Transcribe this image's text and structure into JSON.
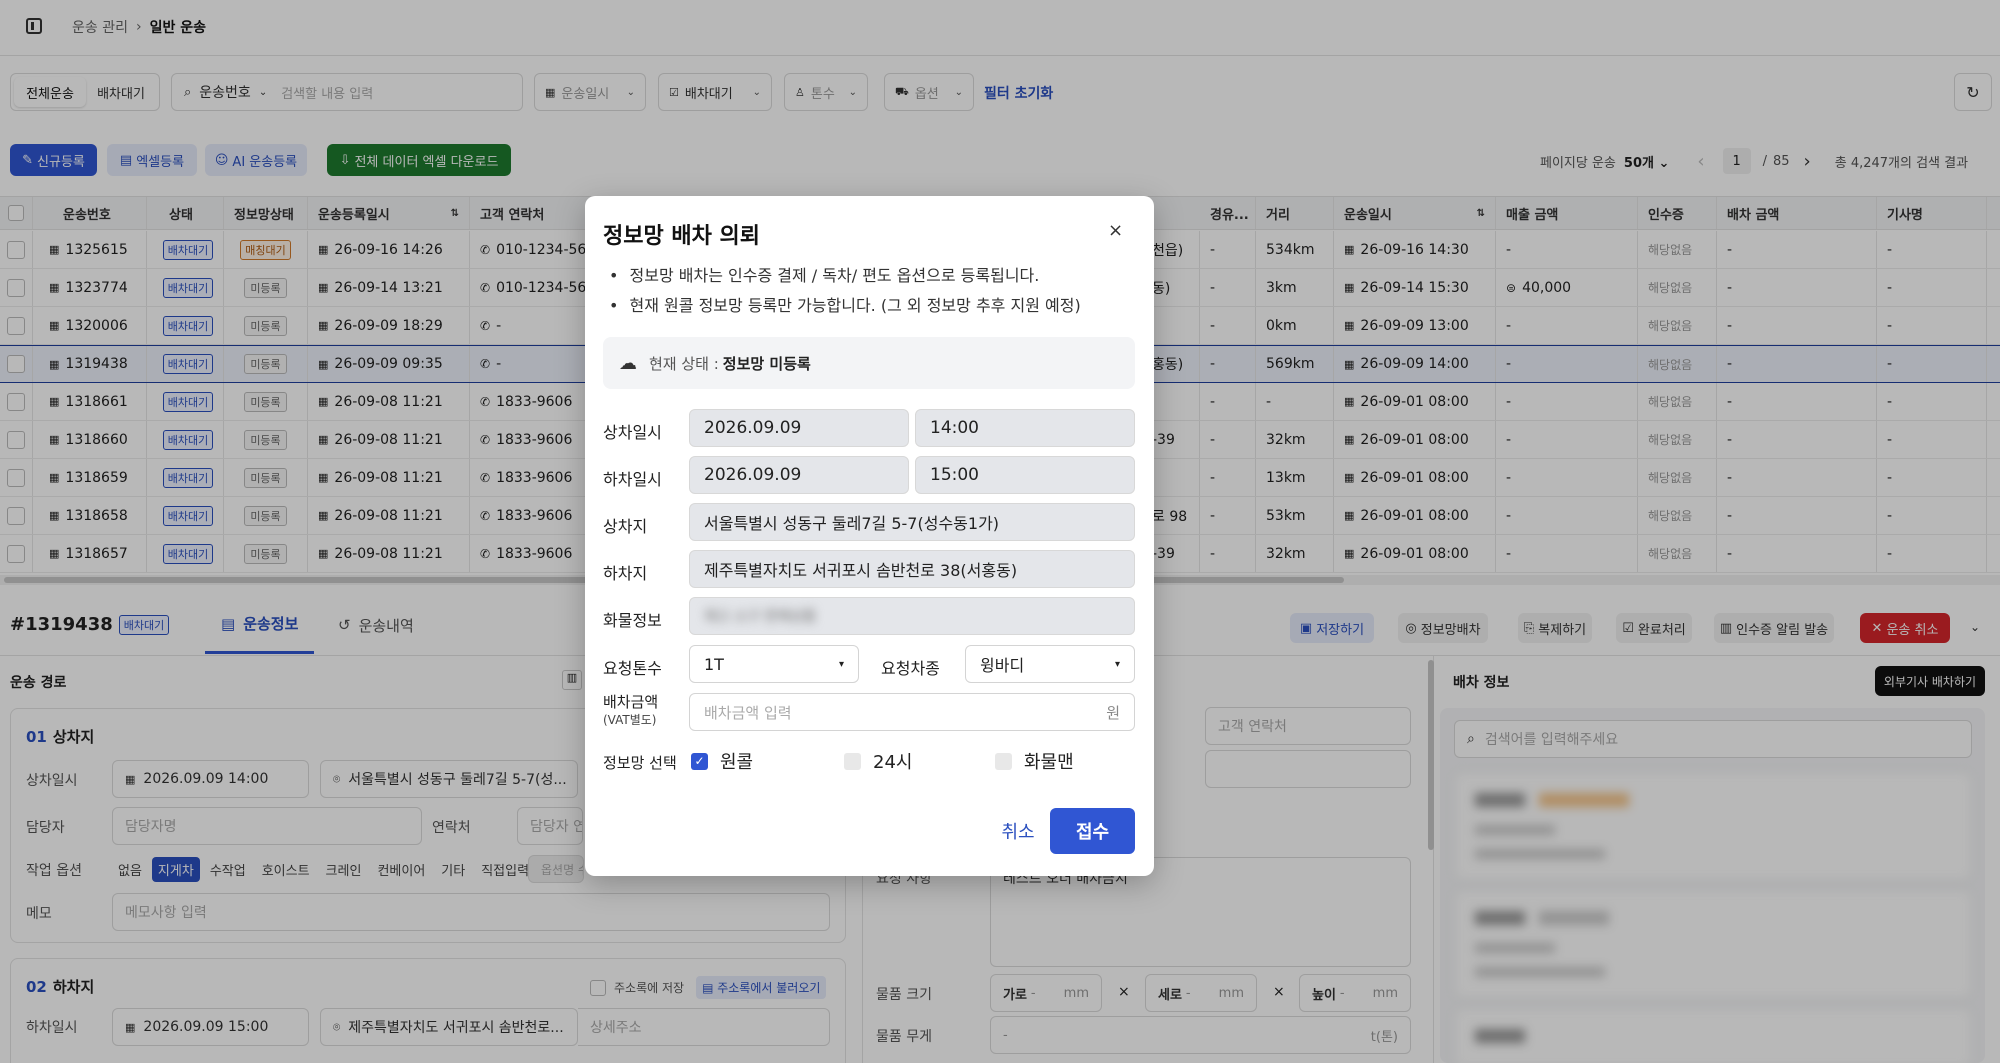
{
  "breadcrumb": {
    "parent": "운송 관리",
    "current": "일반 운송"
  },
  "filters": {
    "tabs": [
      "전체운송",
      "배차대기"
    ],
    "search_field": "운송번호",
    "search_placeholder": "검색할 내용 입력",
    "date": "운송일시",
    "status": "배차대기",
    "tonnage": "톤수",
    "option": "옵션",
    "reset": "필터 초기화"
  },
  "actions": {
    "new": "신규등록",
    "excel": "엑셀등록",
    "ai": "AI 운송등록",
    "download": "전체 데이터 엑셀 다운로드",
    "per_page_label": "페이지당 운송",
    "per_page": "50개",
    "page": "1",
    "page_sep": "/",
    "total_pages": "85",
    "total": "총 4,247개의 검색 결과"
  },
  "table": {
    "headers": [
      "운송번호",
      "상태",
      "정보망상태",
      "운송등록일시",
      "고객 연락처",
      "경유...",
      "거리",
      "운송일시",
      "매출 금액",
      "인수증",
      "배차 금액",
      "기사명"
    ],
    "rows": [
      {
        "id": "1325615",
        "status": "배차대기",
        "net": "매칭대기",
        "reg": "26-09-16 14:26",
        "phone": "010-1234-56",
        "mid": "천읍)",
        "via": "-",
        "dist": "534km",
        "date": "26-09-16 14:30",
        "sales": "-",
        "receipt": "해당없음",
        "pay": "-",
        "driver": "-"
      },
      {
        "id": "1323774",
        "status": "배차대기",
        "net": "미등록",
        "reg": "26-09-14 13:21",
        "phone": "010-1234-56",
        "mid": "동)",
        "via": "-",
        "dist": "3km",
        "date": "26-09-14 15:30",
        "sales": "40,000",
        "receipt": "해당없음",
        "pay": "-",
        "driver": "-"
      },
      {
        "id": "1320006",
        "status": "배차대기",
        "net": "미등록",
        "reg": "26-09-09 18:29",
        "phone": "-",
        "mid": "",
        "via": "-",
        "dist": "0km",
        "date": "26-09-09 13:00",
        "sales": "-",
        "receipt": "해당없음",
        "pay": "-",
        "driver": "-"
      },
      {
        "id": "1319438",
        "status": "배차대기",
        "net": "미등록",
        "reg": "26-09-09 09:35",
        "phone": "-",
        "mid": "홍동)",
        "via": "-",
        "dist": "569km",
        "date": "26-09-09 14:00",
        "sales": "-",
        "receipt": "해당없음",
        "pay": "-",
        "driver": "-"
      },
      {
        "id": "1318661",
        "status": "배차대기",
        "net": "미등록",
        "reg": "26-09-08 11:21",
        "phone": "1833-9606",
        "mid": "",
        "via": "-",
        "dist": "-",
        "date": "26-09-01 08:00",
        "sales": "-",
        "receipt": "해당없음",
        "pay": "-",
        "driver": "-"
      },
      {
        "id": "1318660",
        "status": "배차대기",
        "net": "미등록",
        "reg": "26-09-08 11:21",
        "phone": "1833-9606",
        "mid": "-39",
        "via": "-",
        "dist": "32km",
        "date": "26-09-01 08:00",
        "sales": "-",
        "receipt": "해당없음",
        "pay": "-",
        "driver": "-"
      },
      {
        "id": "1318659",
        "status": "배차대기",
        "net": "미등록",
        "reg": "26-09-08 11:21",
        "phone": "1833-9606",
        "mid": "",
        "via": "-",
        "dist": "13km",
        "date": "26-09-01 08:00",
        "sales": "-",
        "receipt": "해당없음",
        "pay": "-",
        "driver": "-"
      },
      {
        "id": "1318658",
        "status": "배차대기",
        "net": "미등록",
        "reg": "26-09-08 11:21",
        "phone": "1833-9606",
        "mid": "로 98",
        "via": "-",
        "dist": "53km",
        "date": "26-09-01 08:00",
        "sales": "-",
        "receipt": "해당없음",
        "pay": "-",
        "driver": "-"
      },
      {
        "id": "1318657",
        "status": "배차대기",
        "net": "미등록",
        "reg": "26-09-08 11:21",
        "phone": "1833-9606",
        "mid": "-39",
        "via": "-",
        "dist": "32km",
        "date": "26-09-01 08:00",
        "sales": "-",
        "receipt": "해당없음",
        "pay": "-",
        "driver": "-"
      }
    ]
  },
  "detail": {
    "id": "#1319438",
    "badge": "배차대기",
    "tab_info": "운송정보",
    "tab_history": "운송내역",
    "save": "저장하기",
    "netdispatch": "정보망배차",
    "copy": "복제하기",
    "complete": "완료처리",
    "receipt_notify": "인수증 알림 발송",
    "cancel": "운송 취소",
    "route_title": "운송 경로",
    "loading_num": "01",
    "loading_title": "상차지",
    "loading_date_label": "상차일시",
    "loading_date": "2026.09.09 14:00",
    "loading_addr": "서울특별시 성동구 둘레7길 5-7(성...",
    "manager_label": "담당자",
    "manager_ph": "담당자명",
    "contact_label": "연락처",
    "contact_ph": "담당자 연",
    "work_label": "작업 옵션",
    "work_opts": [
      "없음",
      "지게차",
      "수작업",
      "호이스트",
      "크레인",
      "컨베이어",
      "기타",
      "직접입력"
    ],
    "work_custom_ph": "옵션명 수",
    "memo_label": "메모",
    "memo_ph": "메모사항 입력",
    "unloading_num": "02",
    "unloading_title": "하차지",
    "save_addr": "주소록에 저장",
    "load_addr": "주소록에서 불러오기",
    "unloading_date_label": "하차일시",
    "unloading_date": "2026.09.09 15:00",
    "unloading_addr": "제주특별자치도 서귀포시 솜반천로...",
    "detail_addr_ph": "상세주소",
    "customer_phone_ph": "고객 연락처",
    "item_size_label": "물품 크기",
    "w": "가로",
    "h": "세로",
    "d": "높이",
    "unit": "mm",
    "item_weight_label": "물품 무게",
    "weight_unit": "t(톤)",
    "request_text": "테스트 오더 배차금지",
    "request_label": "요청 사항",
    "dispatch_title": "배차 정보",
    "external": "외부기사 배차하기",
    "dispatch_search_ph": "검색어를 입력해주세요"
  },
  "modal": {
    "title": "정보망 배차 의뢰",
    "note1": "정보망 배차는 인수증 결제 / 독차/ 편도 옵션으로 등록됩니다.",
    "note2": "현재 원콜 정보망 등록만 가능합니다. (그 외 정보망 추후 지원 예정)",
    "status_prefix": "현재 상태 : ",
    "status_value": "정보망 미등록",
    "load_label": "상차일시",
    "load_date": "2026.09.09",
    "load_time": "14:00",
    "unload_label": "하차일시",
    "unload_date": "2026.09.09",
    "unload_time": "15:00",
    "origin_label": "상차지",
    "origin": "서울특별시 성동구 둘레7길 5-7(성수동1가)",
    "dest_label": "하차지",
    "dest": "제주특별자치도 서귀포시 솜반천로 38(서홍동)",
    "cargo_label": "화물정보",
    "cargo": "재고 소구 판매상품",
    "tonnage_label": "요청톤수",
    "tonnage": "1T",
    "vehicle_label": "요청차종",
    "vehicle": "윙바디",
    "fee_label": "배차금액",
    "fee_sub": "(VAT별도)",
    "fee_ph": "배차금액 입력",
    "fee_unit": "원",
    "net_label": "정보망 선택",
    "net_options": [
      {
        "label": "원콜",
        "checked": true
      },
      {
        "label": "24시",
        "checked": false
      },
      {
        "label": "화물맨",
        "checked": false
      }
    ],
    "cancel": "취소",
    "submit": "접수"
  },
  "colors": {
    "primary": "#3056d3",
    "dark_green": "#1e7a2e",
    "danger": "#d6262b",
    "badge_blue": "#2a4fbf"
  }
}
